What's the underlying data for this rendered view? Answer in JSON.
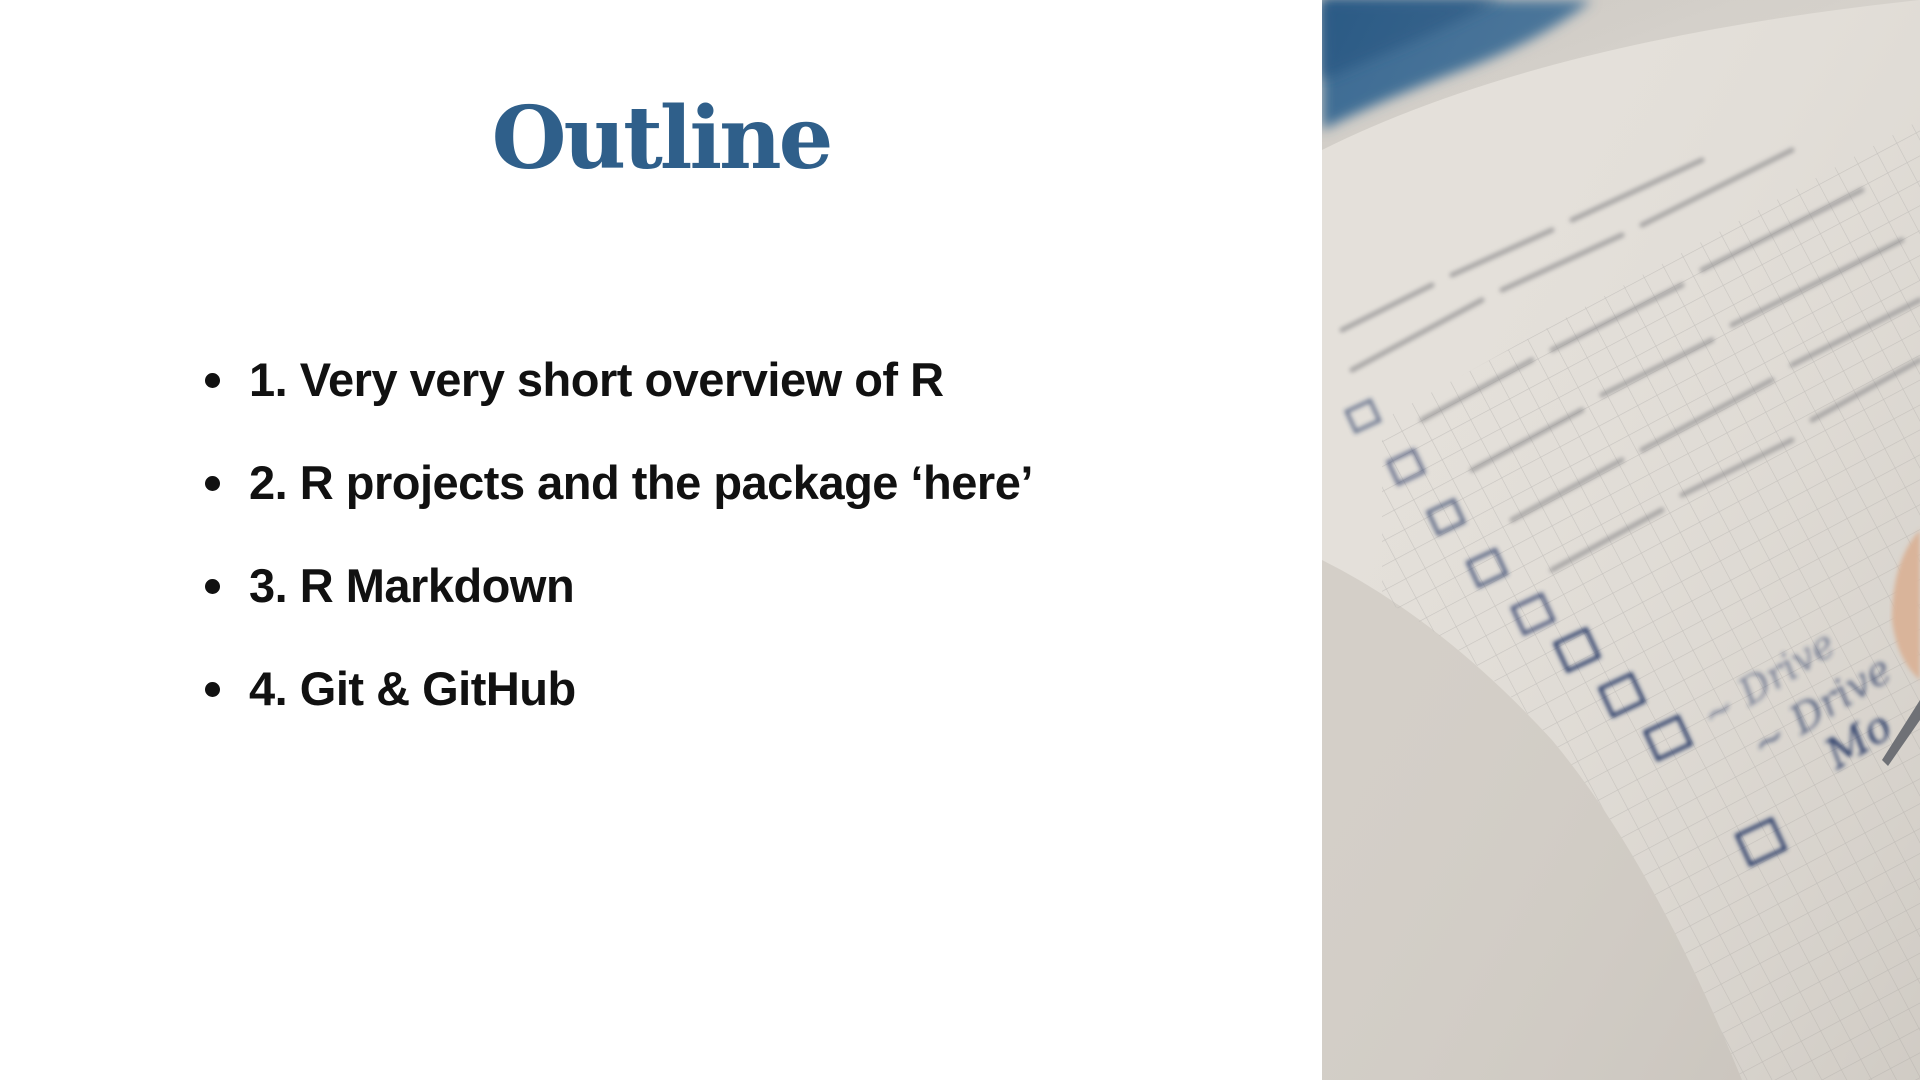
{
  "slide": {
    "title": "Outline",
    "bullets": [
      "1. Very very short overview of R",
      "2. R projects and the package ‘here’",
      "3. R Markdown",
      "4. Git & GitHub"
    ],
    "photo": {
      "description_icon": "checklist-notebook-photo",
      "handwriting": [
        "Drive",
        "Drive",
        "Mo"
      ]
    }
  }
}
